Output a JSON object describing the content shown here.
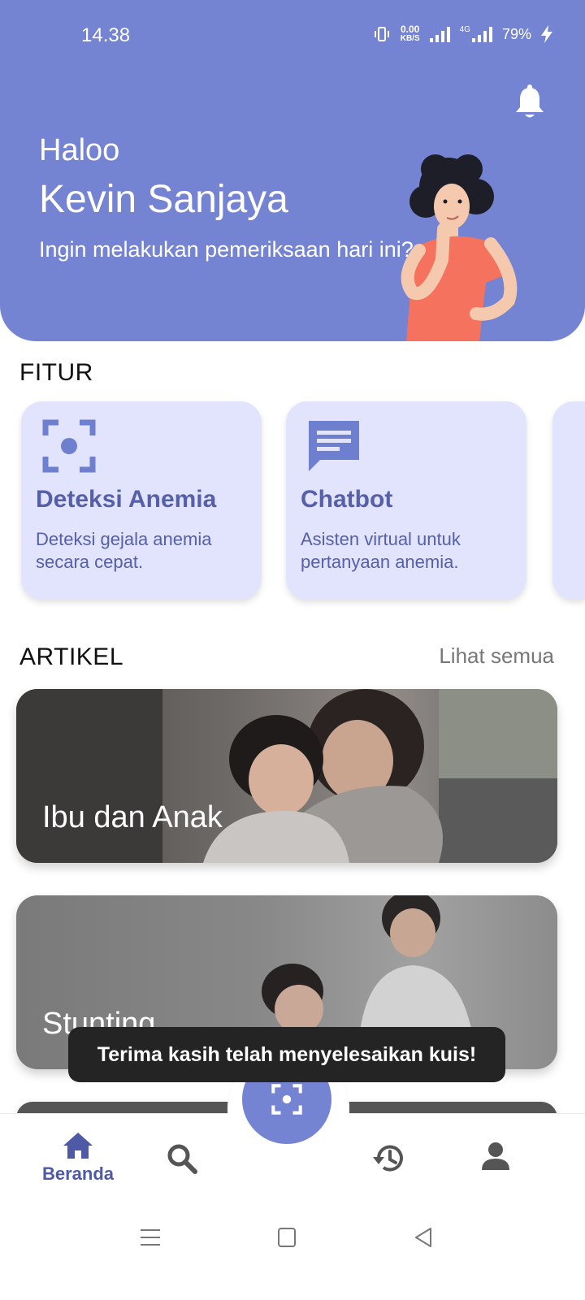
{
  "status_bar": {
    "time": "14.38",
    "net_speed_value": "0.00",
    "net_speed_unit": "KB/S",
    "network_label": "4G",
    "battery": "79%"
  },
  "header": {
    "greeting": "Haloo",
    "user_name": "Kevin Sanjaya",
    "prompt": "Ingin melakukan pemeriksaan hari ini?",
    "accent_color": "#7484d2"
  },
  "features": {
    "title": "FITUR",
    "items": [
      {
        "icon": "scan-icon",
        "title": "Deteksi Anemia",
        "description": "Deteksi gejala anemia secara cepat."
      },
      {
        "icon": "chat-icon",
        "title": "Chatbot",
        "description": "Asisten virtual untuk pertanyaan anemia."
      }
    ]
  },
  "articles": {
    "title": "ARTIKEL",
    "see_all": "Lihat semua",
    "items": [
      {
        "label": "Ibu dan Anak"
      },
      {
        "label": "Stunting"
      }
    ]
  },
  "toast": {
    "message": "Terima kasih telah menyelesaikan kuis!"
  },
  "bottom_nav": {
    "items": [
      {
        "icon": "home-icon",
        "label": "Beranda",
        "active": true
      },
      {
        "icon": "search-icon",
        "label": ""
      },
      {
        "icon": "scan-icon",
        "label": ""
      },
      {
        "icon": "history-icon",
        "label": ""
      },
      {
        "icon": "profile-icon",
        "label": ""
      }
    ]
  }
}
